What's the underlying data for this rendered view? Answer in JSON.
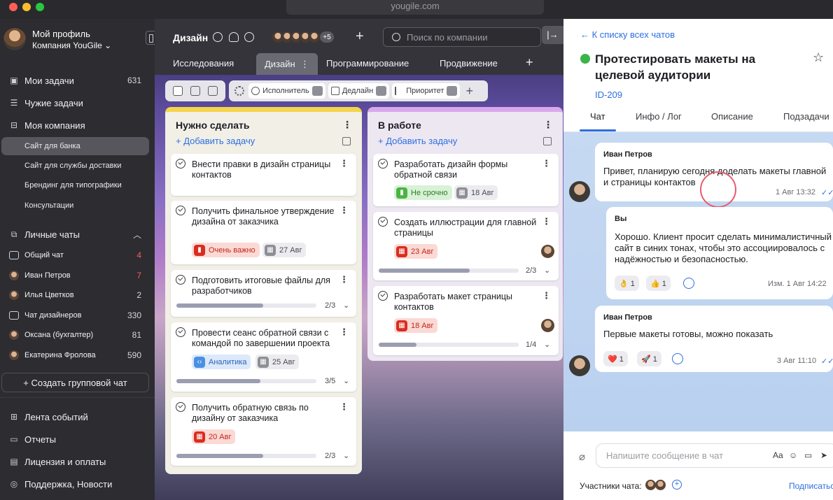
{
  "window": {
    "url": "yougile.com"
  },
  "colors": {
    "accent": "#2d6fe0",
    "todo_column": "#f3d54a",
    "in_progress_column": "#d9a8ec",
    "urgent": "#d92d20",
    "done": "#3bb54a"
  },
  "sidebar": {
    "profile_name": "Мой профиль",
    "company": "Компания YouGile ⌄",
    "my_tasks": {
      "label": "Мои задачи",
      "count": "631"
    },
    "others_tasks": {
      "label": "Чужие задачи"
    },
    "my_company": {
      "label": "Моя компания"
    },
    "projects": [
      "Сайт для банка",
      "Сайт для службы доставки",
      "Брендинг для типографики",
      "Консультации"
    ],
    "personal_chats": {
      "label": "Личные чаты"
    },
    "chats": [
      {
        "name": "Общий чат",
        "count": "4",
        "unread": true,
        "icon": "chat-icon"
      },
      {
        "name": "Иван Петров",
        "count": "7",
        "unread": true,
        "icon": "avatar"
      },
      {
        "name": "Илья Цветков",
        "count": "2",
        "unread": false,
        "icon": "avatar"
      },
      {
        "name": "Чат дизайнеров",
        "count": "330",
        "unread": false,
        "icon": "chat-icon"
      },
      {
        "name": "Оксана (бухгалтер)",
        "count": "81",
        "unread": false,
        "icon": "avatar"
      },
      {
        "name": "Екатерина Фролова",
        "count": "590",
        "unread": false,
        "icon": "avatar"
      }
    ],
    "create_group_chat": "+ Создать групповой чат",
    "bottom": [
      "Лента событий",
      "Отчеты",
      "Лицензия и оплаты",
      "Поддержка, Новости"
    ]
  },
  "board": {
    "project_title": "Дизайн",
    "extra_members": "+5",
    "search_placeholder": "Поиск по компании",
    "tabs": [
      "Исследования",
      "Дизайн",
      "Программирование",
      "Продвижение"
    ],
    "active_tab": "Дизайн",
    "filters": [
      "Исполнитель",
      "Дедлайн",
      "Приоритет"
    ],
    "add_task_label": "+ Добавить задачу",
    "columns": [
      {
        "title": "Нужно сделать",
        "cards": [
          {
            "title": "Внести правки в дизайн страницы контактов"
          },
          {
            "title": "Получить финальное утверждение дизайна от заказчика",
            "priority": "Очень важно",
            "date": "27 Авг"
          },
          {
            "title": "Подготовить итоговые файлы для разработчиков",
            "progress": "2/3",
            "progress_fraction": 0.62
          },
          {
            "title": "Провести сеанс обратной связи с командой по завершении проекта",
            "tag": "Аналитика",
            "date": "25 Авг",
            "progress": "3/5",
            "progress_fraction": 0.6
          },
          {
            "title": "Получить обратную связь по дизайну от заказчика",
            "date": "20 Авг",
            "progress": "2/3",
            "progress_fraction": 0.62
          }
        ]
      },
      {
        "title": "В работе",
        "cards": [
          {
            "title": "Разработать дизайн формы обратной связи",
            "priority": "Не срочно",
            "date": "18 Авг"
          },
          {
            "title": "Создать иллюстрации для главной страницы",
            "date": "23 Авг",
            "progress": "2/3",
            "progress_fraction": 0.65
          },
          {
            "title": "Разработать макет страницы контактов",
            "date": "18 Авг",
            "progress": "1/4",
            "progress_fraction": 0.27
          }
        ]
      }
    ]
  },
  "chat": {
    "back_link": "← К списку всех чатов",
    "task_title": "Протестировать макеты на целевой аудитории",
    "task_id": "ID-209",
    "tabs": [
      "Чат",
      "Инфо / Лог",
      "Описание",
      "Подзадачи"
    ],
    "active_tab": "Чат",
    "messages": [
      {
        "author": "Иван Петров",
        "text": "Привет, планирую сегодня доделать макеты главной и страницы контактов",
        "time": "1 Авг 13:32"
      },
      {
        "author": "Вы",
        "text": "Хорошо. Клиент просит сделать минималистичный сайт в синих тонах, чтобы это ассоциировалось с надёжностью и безопасностью.",
        "reactions": [
          "👌 1",
          "👍 1"
        ],
        "time": "Изм. 1 Авг 14:22"
      },
      {
        "author": "Иван Петров",
        "text": "Первые макеты готовы, можно показать",
        "reactions": [
          "❤️ 1",
          "🚀 1"
        ],
        "time": "3 Авг 11:10"
      }
    ],
    "input_placeholder": "Напишите сообщение в чат",
    "participants_label": "Участники чата:",
    "subscribe": "Подписаться"
  }
}
